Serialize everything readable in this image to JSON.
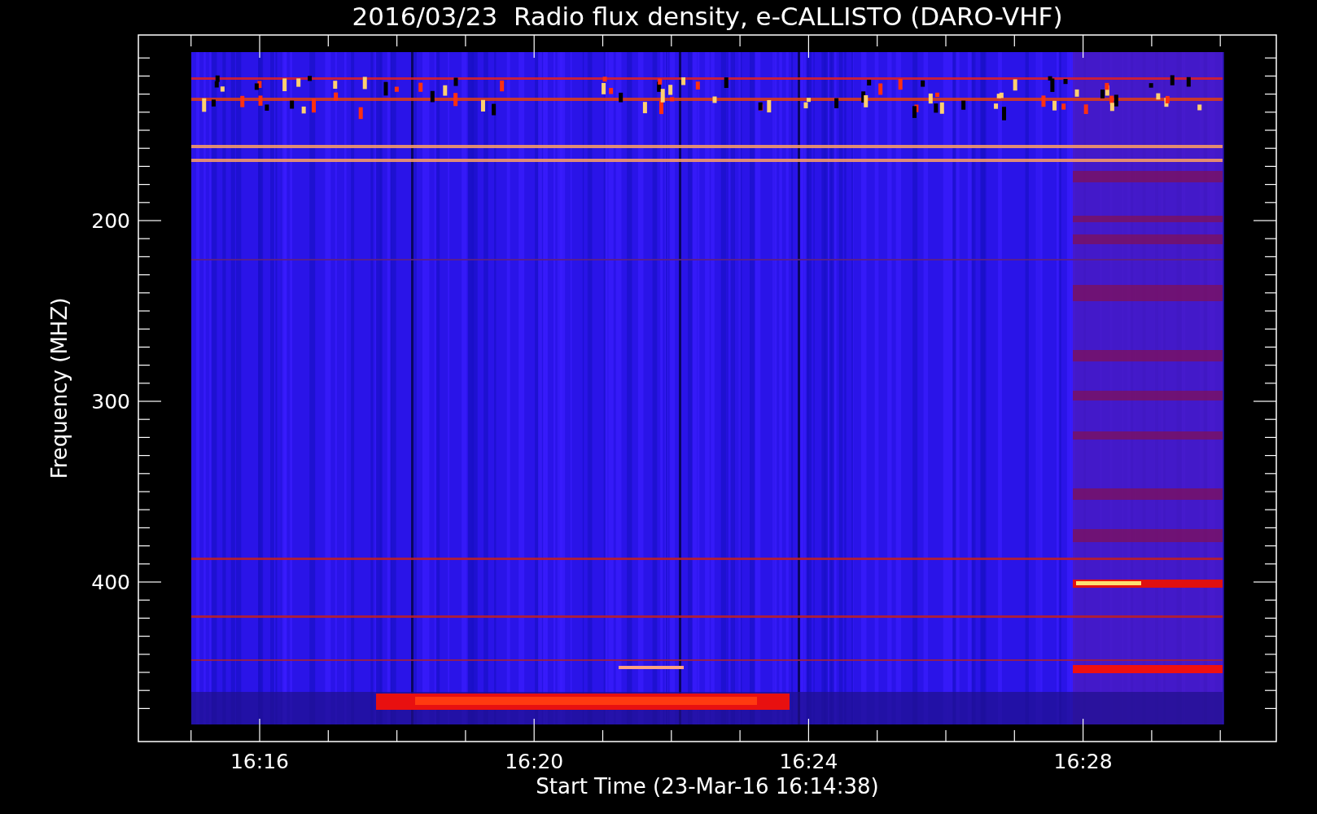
{
  "title": "2016/03/23  Radio flux density, e-CALLISTO (DARO-VHF)",
  "y_axis": {
    "label": "Frequency (MHZ)",
    "tick_labels": [
      "200",
      "300",
      "400"
    ]
  },
  "x_axis": {
    "label": "Start Time (23-Mar-16 16:14:38)",
    "tick_labels": [
      "16:16",
      "16:20",
      "16:24",
      "16:28"
    ]
  }
}
